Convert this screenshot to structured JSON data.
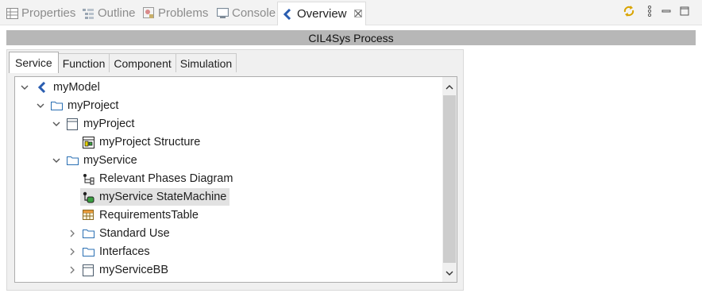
{
  "view_tabs": [
    {
      "label": "Properties",
      "icon": "properties-icon"
    },
    {
      "label": "Outline",
      "icon": "outline-icon"
    },
    {
      "label": "Problems",
      "icon": "problems-icon"
    },
    {
      "label": "Console",
      "icon": "console-icon"
    },
    {
      "label": "Overview",
      "icon": "overview-icon",
      "active": true
    }
  ],
  "toolbar": {
    "sync_icon": "sync-icon",
    "menu_icon": "view-menu-icon",
    "minimize_icon": "minimize-icon",
    "maximize_icon": "maximize-icon"
  },
  "process_title": "CIL4Sys Process",
  "inner_tabs": [
    {
      "label": "Service",
      "selected": true
    },
    {
      "label": "Function"
    },
    {
      "label": "Component"
    },
    {
      "label": "Simulation"
    }
  ],
  "tree": [
    {
      "label": "myModel",
      "icon": "model-icon",
      "depth": 0,
      "expanded": true
    },
    {
      "label": "myProject",
      "icon": "folder-icon",
      "depth": 1,
      "expanded": true
    },
    {
      "label": "myProject",
      "icon": "block-icon",
      "depth": 2,
      "expanded": true
    },
    {
      "label": "myProject Structure",
      "icon": "structure-diagram-icon",
      "depth": 3
    },
    {
      "label": "myService",
      "icon": "folder-icon",
      "depth": 2,
      "expanded": true
    },
    {
      "label": "Relevant Phases Diagram",
      "icon": "phases-diagram-icon",
      "depth": 3
    },
    {
      "label": "myService StateMachine",
      "icon": "state-machine-icon",
      "depth": 3,
      "selected": true
    },
    {
      "label": "RequirementsTable",
      "icon": "requirements-table-icon",
      "depth": 3
    },
    {
      "label": "Standard Use",
      "icon": "folder-icon",
      "depth": 3,
      "expanded": false
    },
    {
      "label": "Interfaces",
      "icon": "folder-icon",
      "depth": 3,
      "expanded": false
    },
    {
      "label": "myServiceBB",
      "icon": "block-icon",
      "depth": 3,
      "expanded": false
    }
  ],
  "colors": {
    "header_band": "#b7b7b7",
    "selection": "#e2e2e2",
    "folder_icon": "#2a6fb3",
    "model_icon": "#2a5db0"
  }
}
